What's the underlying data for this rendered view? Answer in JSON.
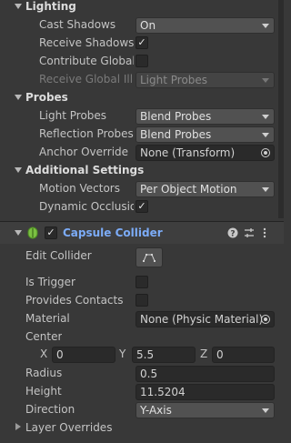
{
  "lighting": {
    "header": "Lighting",
    "cast_shadows_label": "Cast Shadows",
    "cast_shadows_value": "On",
    "receive_shadows_label": "Receive Shadows",
    "receive_shadows_checked": "✓",
    "contribute_gi_label": "Contribute Global I",
    "receive_gi_label": "Receive Global Illu",
    "receive_gi_value": "Light Probes"
  },
  "probes": {
    "header": "Probes",
    "light_probes_label": "Light Probes",
    "light_probes_value": "Blend Probes",
    "reflection_probes_label": "Reflection Probes",
    "reflection_probes_value": "Blend Probes",
    "anchor_override_label": "Anchor Override",
    "anchor_override_value": "None (Transform)"
  },
  "additional": {
    "header": "Additional Settings",
    "motion_vectors_label": "Motion Vectors",
    "motion_vectors_value": "Per Object Motion",
    "dynamic_occlusion_label": "Dynamic Occlusion",
    "dynamic_occlusion_checked": "✓"
  },
  "capsule": {
    "title": "Capsule Collider",
    "enabled_check": "✓",
    "edit_collider_label": "Edit Collider",
    "is_trigger_label": "Is Trigger",
    "provides_contacts_label": "Provides Contacts",
    "material_label": "Material",
    "material_value": "None (Physic Material)",
    "center_label": "Center",
    "center_x_label": "X",
    "center_x": "0",
    "center_y_label": "Y",
    "center_y": "5.5",
    "center_z_label": "Z",
    "center_z": "0",
    "radius_label": "Radius",
    "radius_value": "0.5",
    "height_label": "Height",
    "height_value": "11.5204",
    "direction_label": "Direction",
    "direction_value": "Y-Axis",
    "layer_overrides_label": "Layer Overrides"
  },
  "colors": {
    "accent": "#7cacf8",
    "panel": "#383838",
    "field": "#2a2a2a"
  }
}
